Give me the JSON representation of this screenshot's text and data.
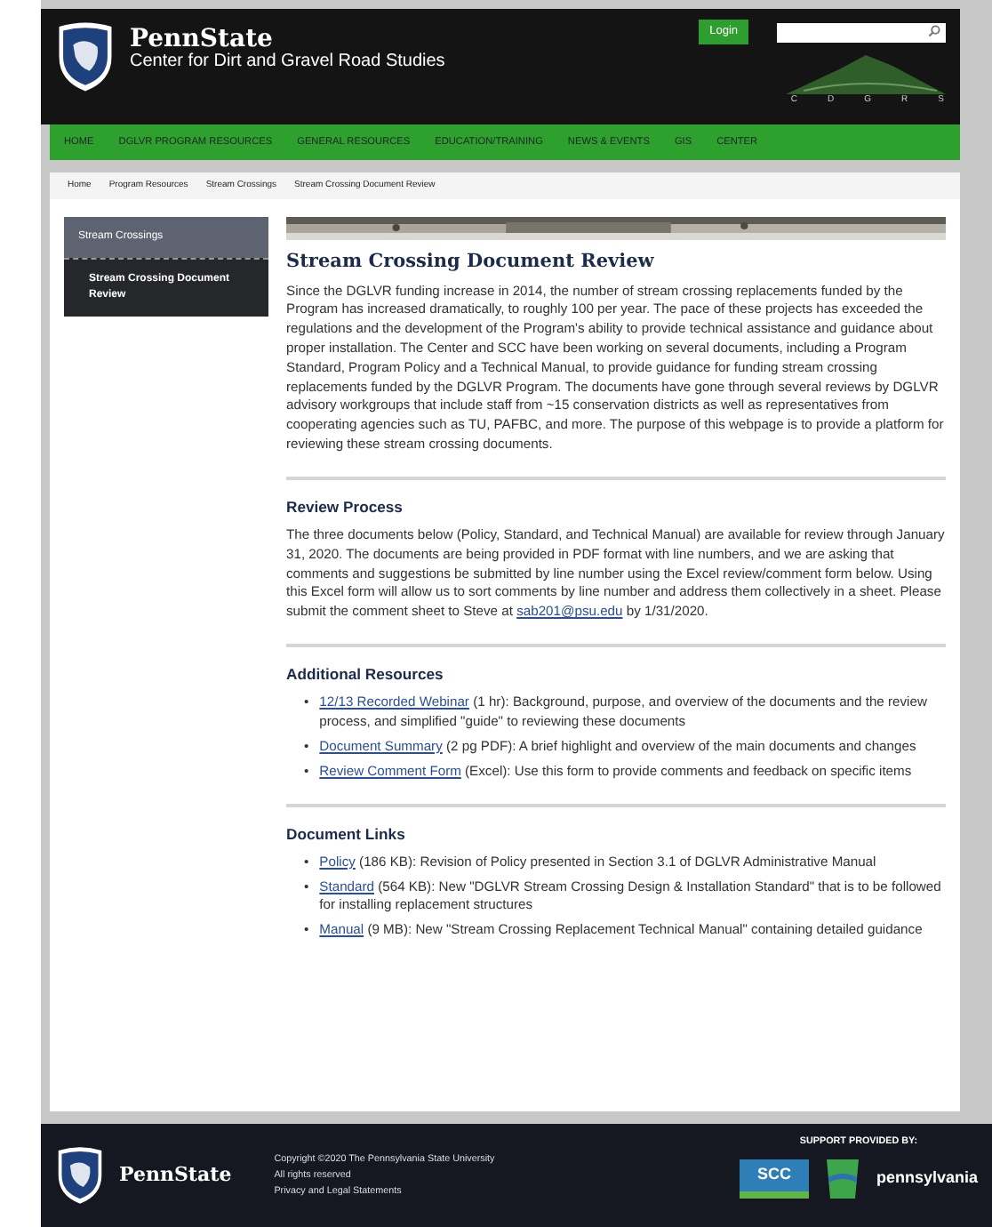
{
  "header": {
    "brand": "PennState",
    "subtitle": "Center for Dirt and Gravel Road Studies",
    "login": "Login",
    "logo_letters": [
      "C",
      "D",
      "G",
      "R",
      "S"
    ]
  },
  "nav": [
    {
      "label": "HOME",
      "selected": false
    },
    {
      "label": "DGLVR PROGRAM RESOURCES",
      "selected": false
    },
    {
      "label": "GENERAL RESOURCES",
      "selected": false
    },
    {
      "label": "EDUCATION/TRAINING",
      "selected": false
    },
    {
      "label": "NEWS & EVENTS",
      "selected": false
    },
    {
      "label": "GIS",
      "selected": false
    },
    {
      "label": "CENTER",
      "selected": false
    }
  ],
  "breadcrumbs": [
    "Home",
    "Program Resources",
    "Stream Crossings",
    "Stream Crossing Document Review"
  ],
  "sidebar": [
    {
      "label": "Stream Crossings",
      "selected": false
    },
    {
      "label": "Stream Crossing Document Review",
      "selected": true
    }
  ],
  "page": {
    "title": "Stream Crossing Document Review",
    "intro": "Since the DGLVR funding increase in 2014, the number of stream crossing replacements funded by the Program has increased dramatically, to roughly 100 per year. The pace of these projects has exceeded the regulations and the development of the Program's ability to provide technical assistance and guidance about proper installation. The Center and SCC have been working on several documents, including a Program Standard, Program Policy and a Technical Manual, to provide guidance for funding stream crossing replacements funded by the DGLVR Program. The documents have gone through several reviews by DGLVR advisory workgroups that include staff from ~15 conservation districts as well as representatives from cooperating agencies such as TU, PAFBC, and more. The purpose of this webpage is to provide a platform for reviewing these stream crossing documents.",
    "sections": [
      {
        "heading": "Review Process",
        "kind": "paragraph",
        "text": "The three documents below (Policy, Standard, and Technical Manual) are available for review through January 31, 2020. The documents are being provided in PDF format with line numbers, and we are asking that comments and suggestions be submitted by line number using the Excel review/comment form below. Using this Excel form will allow us to sort comments by line number and address them collectively in a sheet. Please submit the comment sheet to Steve at",
        "link": "sab201@psu.edu",
        "after": "by 1/31/2020."
      },
      {
        "heading": "Additional Resources",
        "kind": "list",
        "items": [
          {
            "marker": "•",
            "link": "12/13 Recorded Webinar",
            "text": "(1 hr): Background, purpose, and overview of the documents and the review process, and simplified \"guide\" to reviewing these documents"
          },
          {
            "marker": "•",
            "link": "Document Summary",
            "text": "(2 pg PDF): A brief highlight and overview of the main documents and changes"
          },
          {
            "marker": "•",
            "link": "Review Comment Form",
            "text": "(Excel): Use this form to provide comments and feedback on specific items"
          }
        ]
      },
      {
        "heading": "Document Links",
        "kind": "list",
        "items": [
          {
            "marker": "•",
            "link": "Policy",
            "text": "(186 KB): Revision of Policy presented in Section 3.1 of DGLVR Administrative Manual"
          },
          {
            "marker": "•",
            "link": "Standard",
            "text": "(564 KB): New \"DGLVR Stream Crossing Design & Installation Standard\" that is to be followed for installing replacement structures"
          },
          {
            "marker": "•",
            "link": "Manual",
            "text": "(9 MB): New \"Stream Crossing Replacement Technical Manual\" containing detailed guidance"
          }
        ]
      }
    ]
  },
  "footer": {
    "brand": "PennState",
    "lines": [
      "Copyright ©2020 The Pennsylvania State University",
      "All rights reserved",
      "Privacy and Legal Statements"
    ],
    "support": "SUPPORT PROVIDED BY:",
    "scc": "SCC",
    "pa": "pennsylvania"
  }
}
